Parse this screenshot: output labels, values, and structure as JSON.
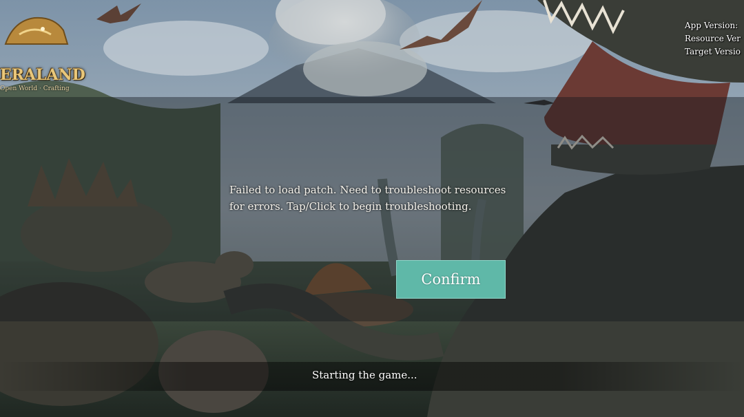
{
  "logo": {
    "wordmark": "ERALAND",
    "tagline": "Open World · Crafting"
  },
  "version_info": {
    "app_version": "App Version:",
    "resource_version": "Resource Ver",
    "target_version": "Target Versio"
  },
  "dialog": {
    "message": "Failed to load patch. Need to troubleshoot resources for errors. Tap/Click to begin troubleshooting.",
    "confirm_label": "Confirm"
  },
  "status": {
    "text": "Starting the game..."
  },
  "colors": {
    "confirm_bg": "#5fb8a8",
    "overlay": "rgba(20,24,28,0.42)"
  }
}
